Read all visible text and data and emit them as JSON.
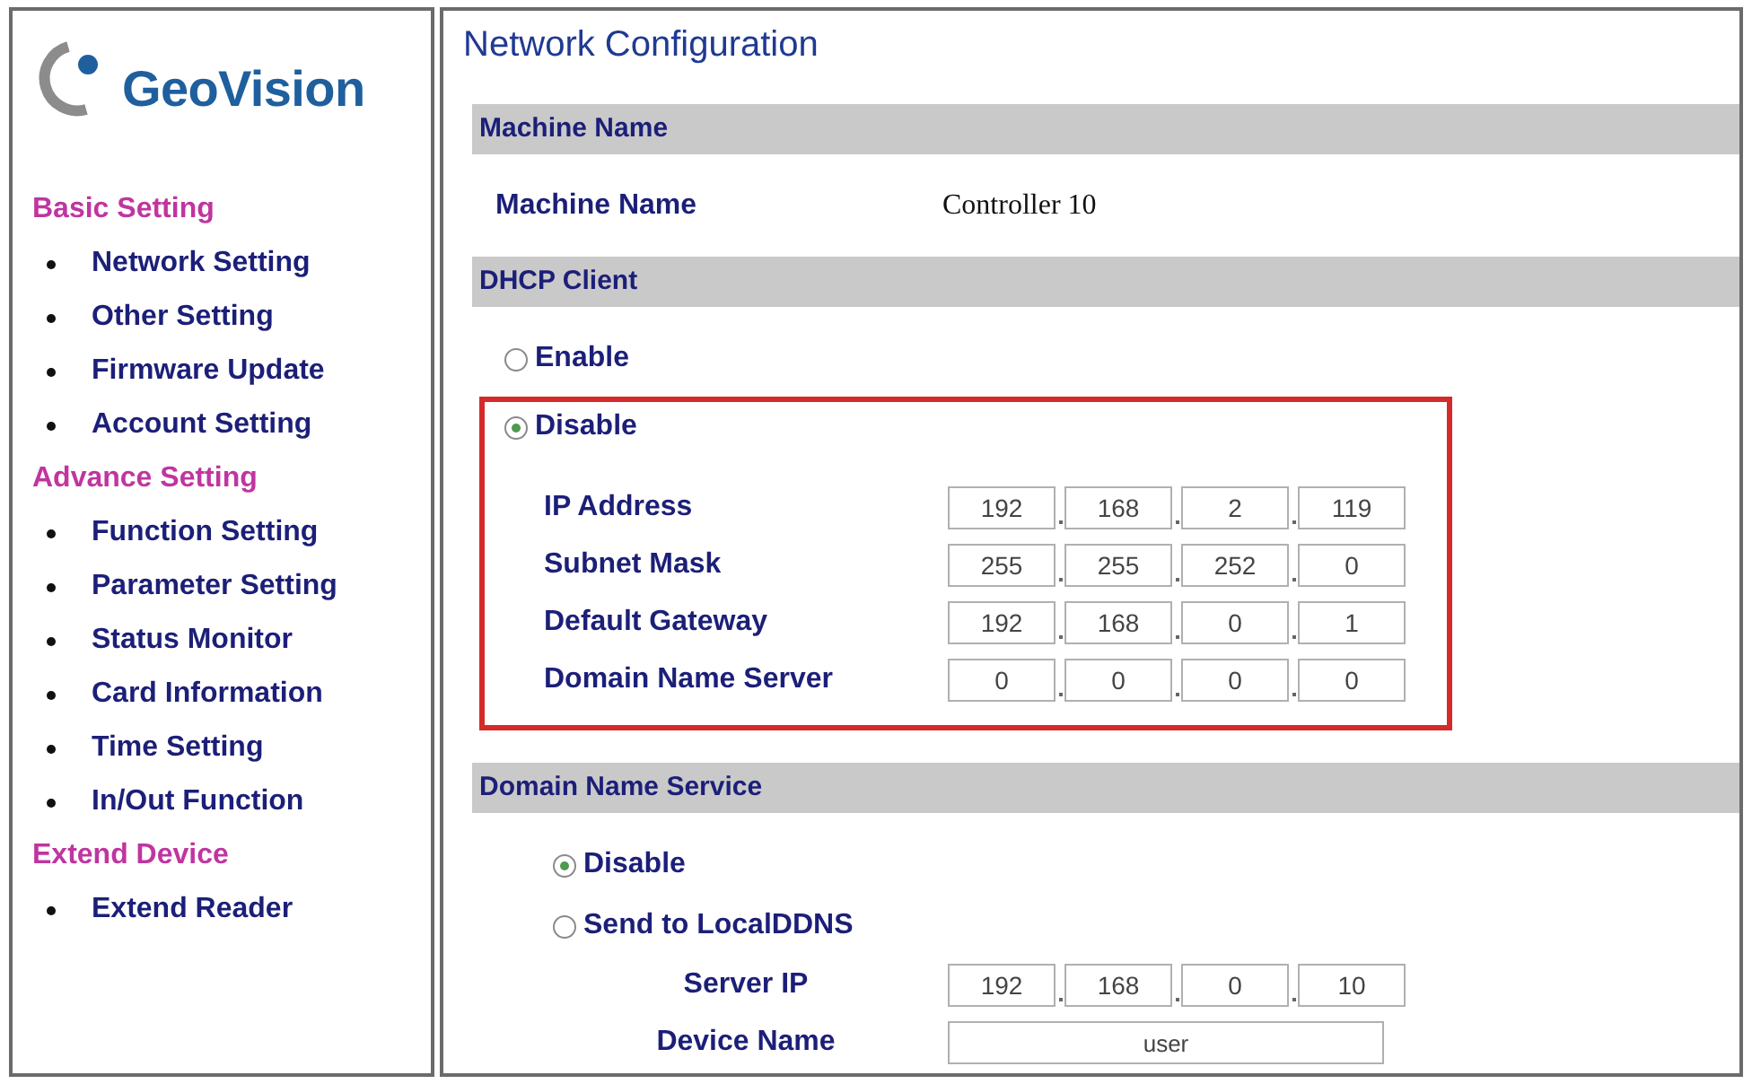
{
  "logo": {
    "text": "GeoVision"
  },
  "sidebar": {
    "groups": [
      {
        "title": "Basic Setting",
        "items": [
          {
            "label": "Network Setting"
          },
          {
            "label": "Other Setting"
          },
          {
            "label": "Firmware Update"
          },
          {
            "label": "Account Setting"
          }
        ]
      },
      {
        "title": "Advance Setting",
        "items": [
          {
            "label": "Function Setting"
          },
          {
            "label": "Parameter Setting"
          },
          {
            "label": "Status Monitor"
          },
          {
            "label": "Card Information"
          },
          {
            "label": "Time Setting"
          },
          {
            "label": "In/Out Function"
          }
        ]
      },
      {
        "title": "Extend Device",
        "items": [
          {
            "label": "Extend Reader"
          }
        ]
      }
    ]
  },
  "page": {
    "title": "Network Configuration",
    "sections": [
      {
        "kind": "info",
        "title": "Machine Name",
        "rows": [
          {
            "label": "Machine Name",
            "value": "Controller 10"
          }
        ]
      },
      {
        "kind": "dhcp",
        "title": "DHCP Client",
        "options": [
          {
            "label": "Enable",
            "selected": false,
            "highlighted": false
          },
          {
            "label": "Disable",
            "selected": true,
            "highlighted": true,
            "fields": [
              {
                "kind": "ip",
                "label": "IP Address",
                "octets": [
                  "192",
                  "168",
                  "2",
                  "119"
                ]
              },
              {
                "kind": "ip",
                "label": "Subnet Mask",
                "octets": [
                  "255",
                  "255",
                  "252",
                  "0"
                ]
              },
              {
                "kind": "ip",
                "label": "Default Gateway",
                "octets": [
                  "192",
                  "168",
                  "0",
                  "1"
                ]
              },
              {
                "kind": "ip",
                "label": "Domain Name Server",
                "octets": [
                  "0",
                  "0",
                  "0",
                  "0"
                ]
              }
            ]
          }
        ]
      },
      {
        "kind": "dns",
        "title": "Domain Name Service",
        "options": [
          {
            "label": "Disable",
            "selected": true
          },
          {
            "label": "Send to LocalDDNS",
            "selected": false,
            "fields": [
              {
                "kind": "ip",
                "label": "Server IP",
                "octets": [
                  "192",
                  "168",
                  "0",
                  "10"
                ]
              },
              {
                "kind": "text",
                "label": "Device Name",
                "value": "user"
              }
            ]
          }
        ]
      }
    ]
  }
}
